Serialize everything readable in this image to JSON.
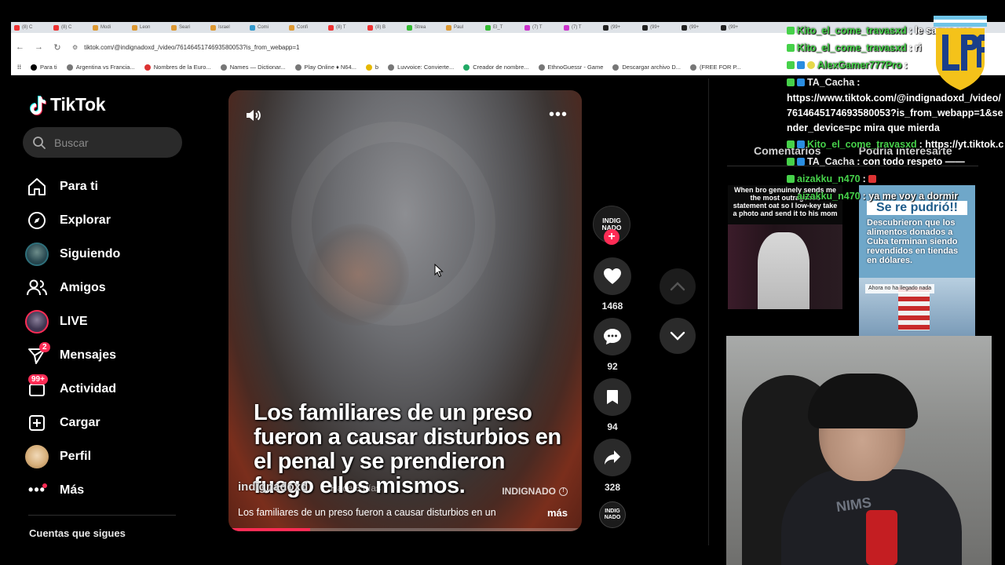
{
  "browser": {
    "url": "tiktok.com/@indignadoxd_/video/7614645174693580053?is_from_webapp=1",
    "tabs": [
      "(8) C",
      "(8) C",
      "Modi",
      "Leon",
      "Seari",
      "Israel",
      "Comi",
      "Confi",
      "(8) T",
      "(8) B",
      "Strea",
      "Paul",
      "El_T",
      "(7) T",
      "(7) T",
      "(99+",
      "(99+",
      "(99+",
      "(99+"
    ],
    "bookmarks": [
      "Para ti",
      "Argentina vs Francia...",
      "Nombres de la Euro...",
      "Names — Dictionar...",
      "Play Online ♦ N64...",
      "b",
      "Luvvoice: Convierte...",
      "Creador de nombre...",
      "EthnoGuessr - Game",
      "Descargar archivo D...",
      "(FREE FOR P..."
    ]
  },
  "tiktok": {
    "logo": "TikTok",
    "search_placeholder": "Buscar",
    "menu": {
      "para_ti": "Para ti",
      "explorar": "Explorar",
      "siguiendo": "Siguiendo",
      "amigos": "Amigos",
      "live": "LIVE",
      "mensajes": "Mensajes",
      "mensajes_badge": "2",
      "actividad": "Actividad",
      "actividad_badge": "99+",
      "cargar": "Cargar",
      "perfil": "Perfil",
      "mas": "Más"
    },
    "following_header": "Cuentas que sigues"
  },
  "video": {
    "caption_overlay": "Los familiares de un preso fueron a causar disturbios en el penal y se prendieron fuego ellos mismos.",
    "author": "indignadoxd",
    "author_date": "Hace 6 días",
    "watermark": "INDIGNADO",
    "description": "Los familiares de un preso fueron a causar disturbios en un",
    "more": "más",
    "progress_fraction": 0.23,
    "avatar_text": "INDIG NADO",
    "likes": "1468",
    "comments": "92",
    "saves": "94",
    "shares": "328"
  },
  "right_panel": {
    "tab_comments": "Comentarios",
    "tab_suggested": "Podría interesarte",
    "thumb1_text": "When bro genuinely sends me the most outrageous statement oat so I low-key take a photo and send it to his mom",
    "thumb2_title": "Se re pudrió!!",
    "thumb2_body": "Descubrieron que los alimentos donados a Cuba terminan siendo revendidos en tiendas en dólares.",
    "thumb2_small": "Ahora no ha llegado nada"
  },
  "chat": [
    {
      "user": "Kito_el_come_travasxd",
      "msg": ": le saque ver",
      "color": "#46d14a"
    },
    {
      "user": "Kito_el_come_travasxd",
      "msg": ": ri",
      "color": "#46d14a"
    },
    {
      "user": "AlexGamer777Pro",
      "msg": ": ",
      "color": "#46d14a"
    },
    {
      "user": "TA_Cacha",
      "msg": ":",
      "color": "#e8e8e8"
    },
    {
      "user": "",
      "msg": "https://www.tiktok.com/@indignadoxd_/video/7614645174693580053?is_from_webapp=1&sender_device=pc mira que mierda",
      "color": "#fff"
    },
    {
      "user": "Kito_el_come_travasxd",
      "msg": ": https://yt.tiktok.c",
      "color": "#46d14a"
    },
    {
      "user": "TA_Cacha",
      "msg": ": con todo respeto ——",
      "color": "#e8e8e8"
    },
    {
      "user": "aizakku_n470",
      "msg": ":",
      "color": "#e6d84a"
    },
    {
      "user": "aizakku_n470",
      "msg": ": ya me voy a dormir",
      "color": "#e6d84a"
    }
  ],
  "stream_logo": "AFA LPF",
  "colors": {
    "accent": "#fe2c55",
    "chat_green": "#46d14a",
    "chat_yellow": "#e6d84a"
  }
}
